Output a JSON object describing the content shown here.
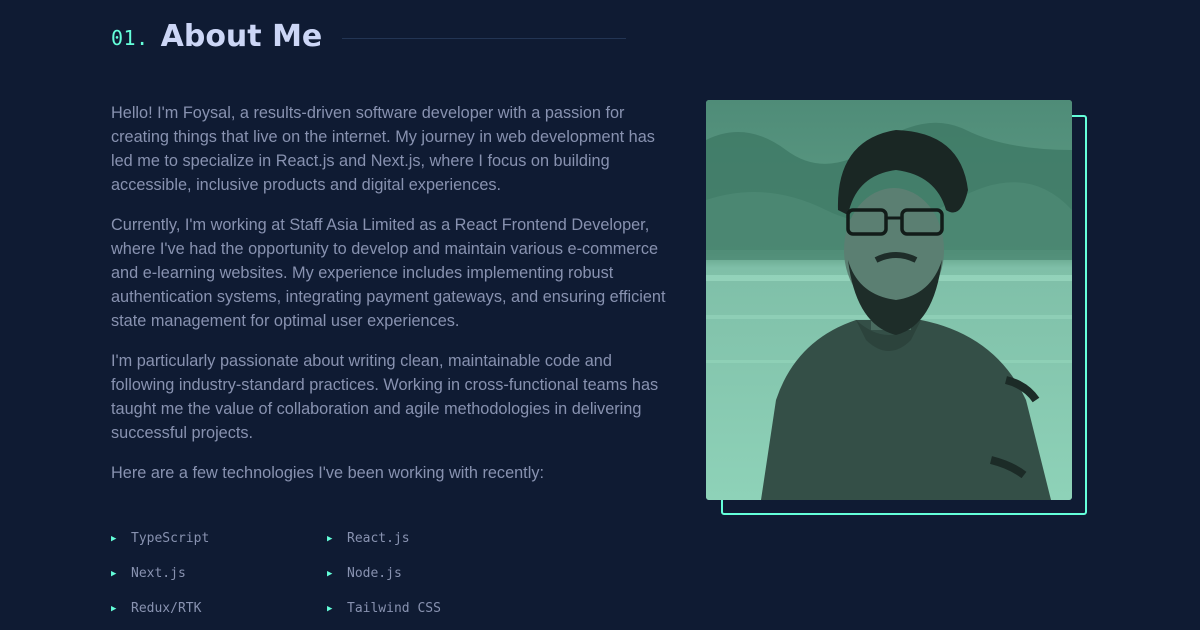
{
  "section": {
    "number": "01.",
    "title": "About Me"
  },
  "about": {
    "paragraphs": [
      "Hello! I'm Foysal, a results-driven software developer with a passion for creating things that live on the internet. My journey in web development has led me to specialize in React.js and Next.js, where I focus on building accessible, inclusive products and digital experiences.",
      "Currently, I'm working at Staff Asia Limited as a React Frontend Developer, where I've had the opportunity to develop and maintain various e-commerce and e-learning websites. My experience includes implementing robust authentication systems, integrating payment gateways, and ensuring efficient state management for optimal user experiences.",
      "I'm particularly passionate about writing clean, maintainable code and following industry-standard practices. Working in cross-functional teams has taught me the value of collaboration and agile methodologies in delivering successful projects.",
      "Here are a few technologies I've been working with recently:"
    ],
    "technologies": [
      "TypeScript",
      "React.js",
      "Next.js",
      "Node.js",
      "Redux/RTK",
      "Tailwind CSS"
    ],
    "bullet_icon": "triangle-right-icon"
  },
  "photo": {
    "subject": "profile-photo",
    "tint_color": "#64ffda"
  },
  "colors": {
    "background": "#0f1b33",
    "accent": "#64ffda",
    "heading": "#ccd6f6",
    "body_text": "#8892b0",
    "divider": "#233554"
  }
}
